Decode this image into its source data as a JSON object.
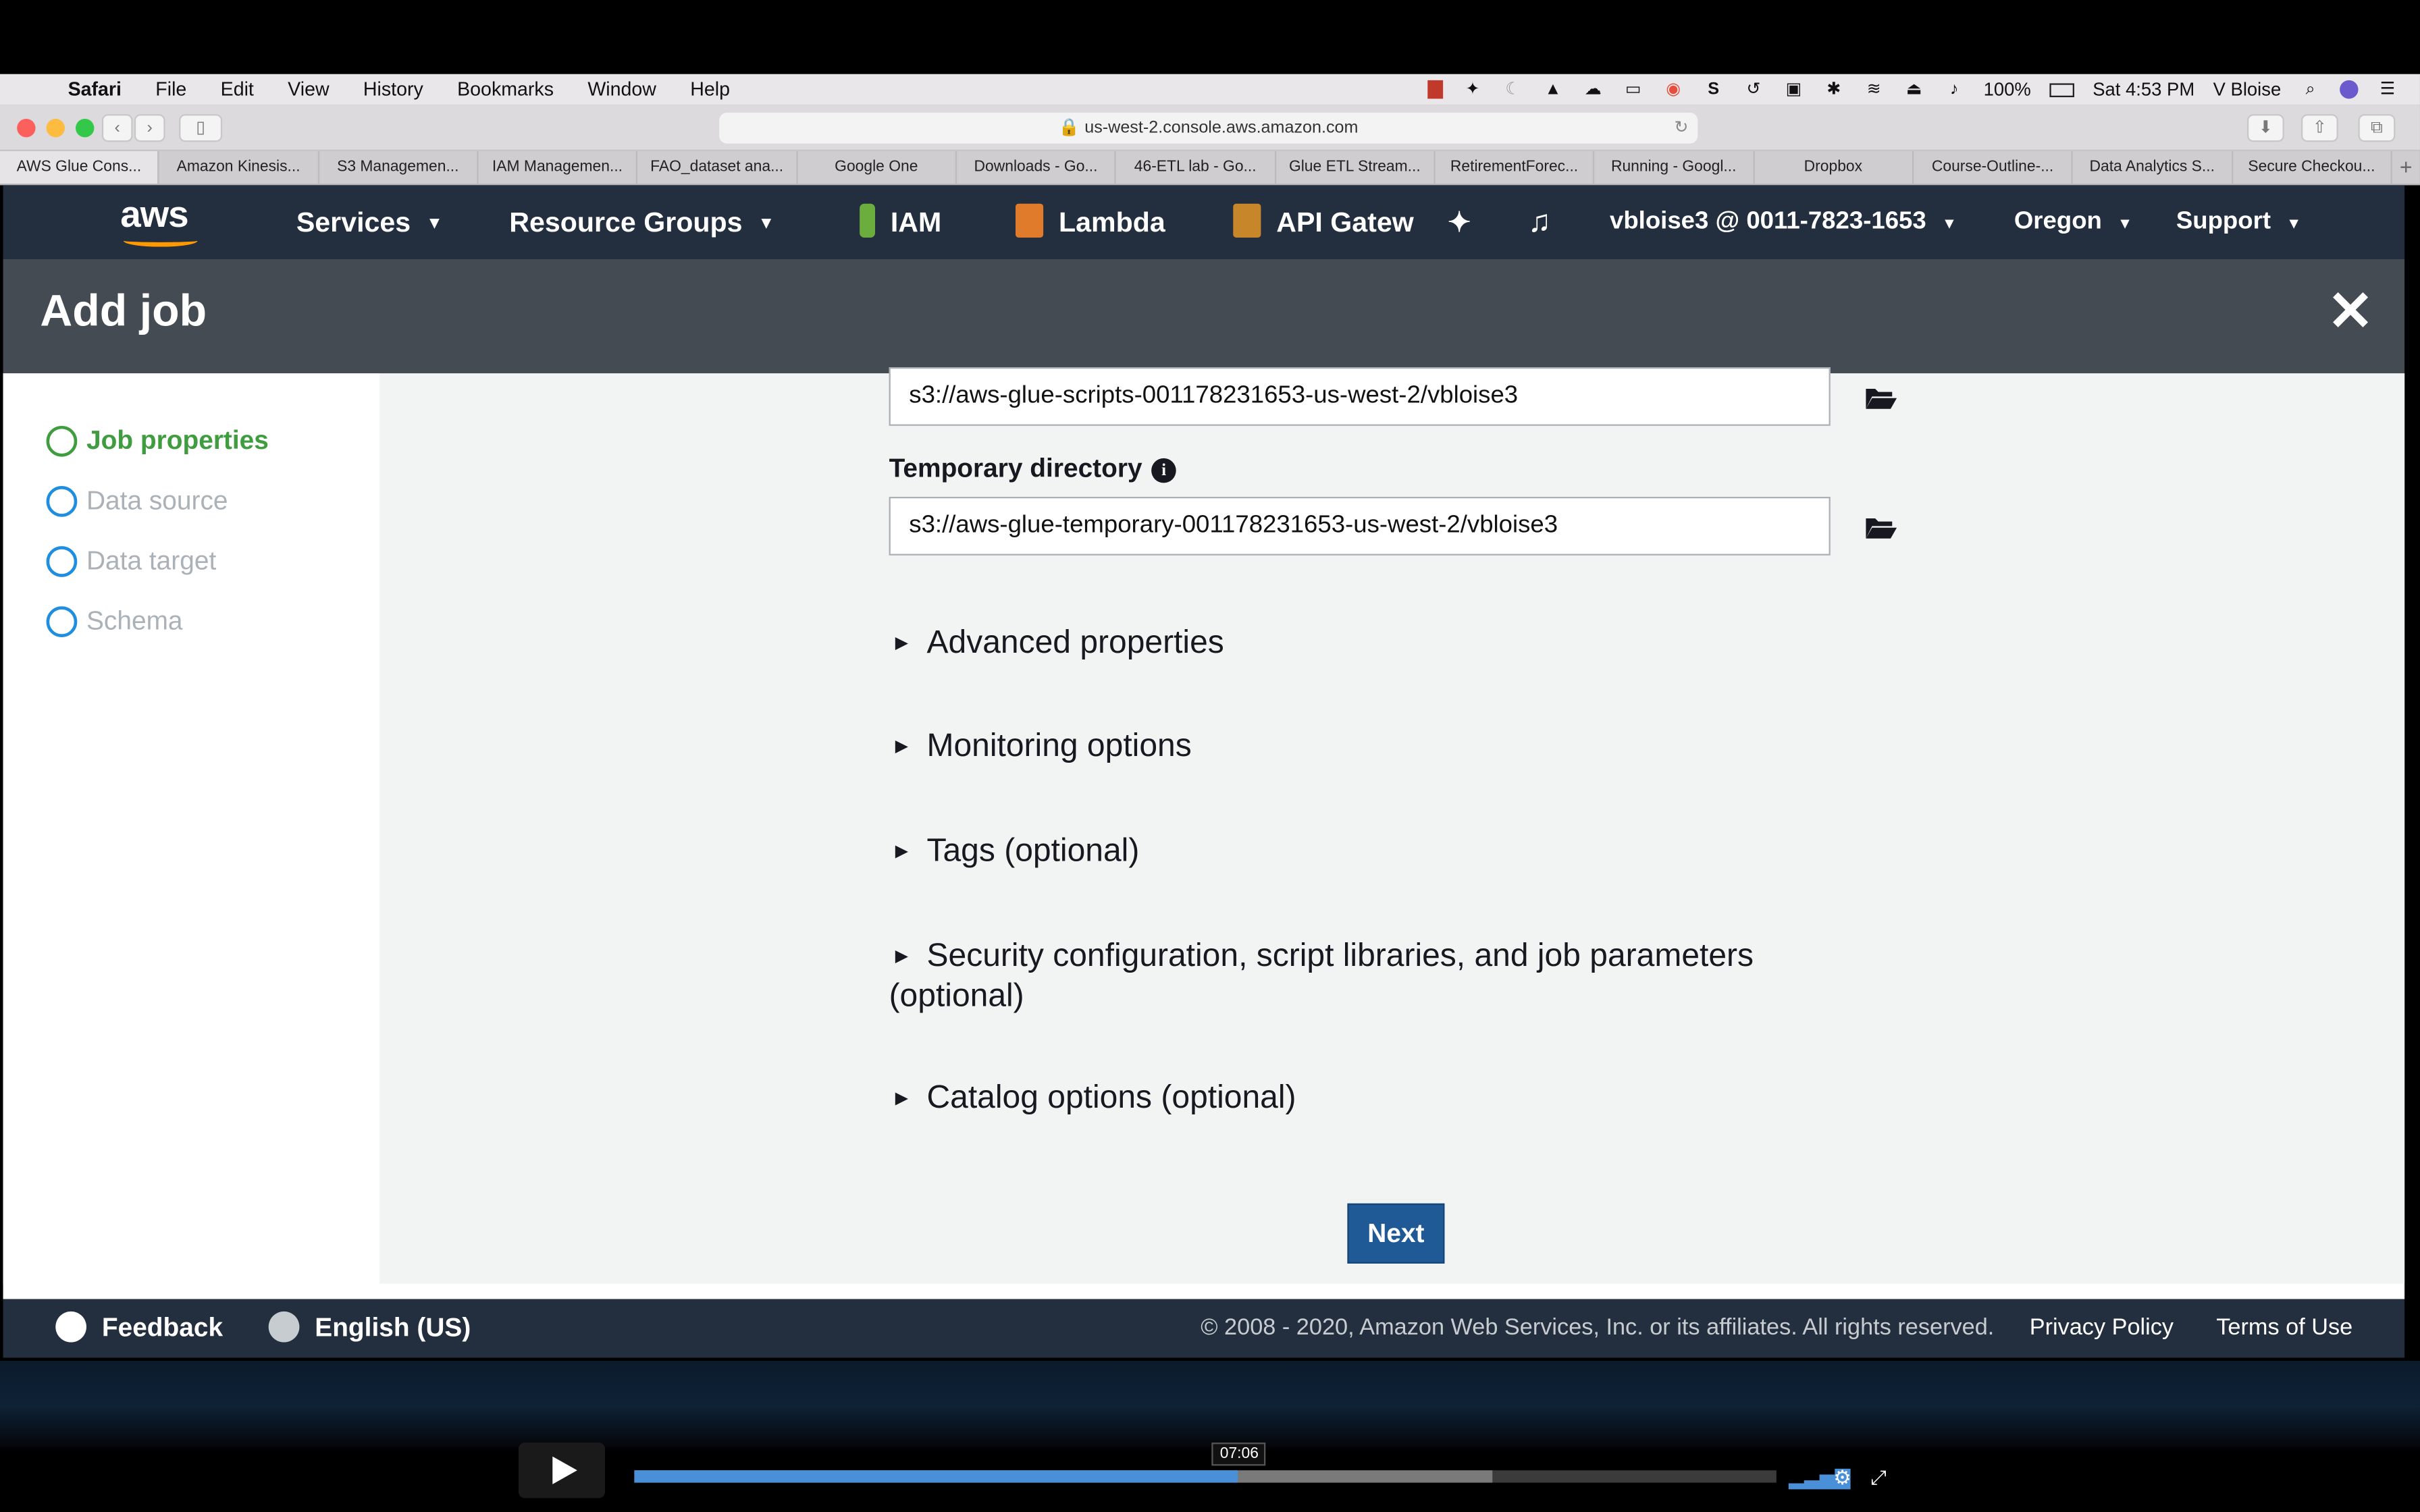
{
  "menubar": {
    "app": "Safari",
    "menus": [
      "File",
      "Edit",
      "View",
      "History",
      "Bookmarks",
      "Window",
      "Help"
    ],
    "battery": "100%",
    "clock": "Sat 4:53 PM",
    "user": "V Bloise"
  },
  "browser": {
    "url": "us-west-2.console.aws.amazon.com",
    "tabs": [
      "AWS Glue Cons...",
      "Amazon Kinesis...",
      "S3 Managemen...",
      "IAM Managemen...",
      "FAO_dataset ana...",
      "Google One",
      "Downloads - Go...",
      "46-ETL lab - Go...",
      "Glue ETL Stream...",
      "RetirementForec...",
      "Running - Googl...",
      "Dropbox",
      "Course-Outline-...",
      "Data Analytics S...",
      "Secure Checkou..."
    ]
  },
  "awsnav": {
    "services": "Services",
    "resource_groups": "Resource Groups",
    "iam": "IAM",
    "lambda": "Lambda",
    "api_gateway": "API Gatew",
    "account": "vbloise3 @ 0011-7823-1653",
    "region": "Oregon",
    "support": "Support"
  },
  "header": {
    "title": "Add job"
  },
  "steps": [
    "Job properties",
    "Data source",
    "Data target",
    "Schema"
  ],
  "form": {
    "script_path_value": "s3://aws-glue-scripts-001178231653-us-west-2/vbloise3",
    "temp_dir_label": "Temporary directory",
    "temp_dir_value": "s3://aws-glue-temporary-001178231653-us-west-2/vbloise3",
    "sections": [
      "Advanced properties",
      "Monitoring options",
      "Tags (optional)",
      "Security configuration, script libraries, and job parameters (optional)",
      "Catalog options (optional)"
    ],
    "next_label": "Next"
  },
  "footer": {
    "feedback": "Feedback",
    "language": "English (US)",
    "copyright": "© 2008 - 2020, Amazon Web Services, Inc. or its affiliates. All rights reserved.",
    "privacy": "Privacy Policy",
    "terms": "Terms of Use"
  },
  "video": {
    "time": "07:06",
    "played_fraction": 0.529,
    "buffered_fraction": 0.751
  },
  "colors": {
    "aws_nav": "#232f3e",
    "aws_orange": "#ff9900",
    "header": "#444b53",
    "step_active": "#3f9d3f",
    "step_circle": "#1f8ee0",
    "primary_button": "#1f5a96"
  }
}
